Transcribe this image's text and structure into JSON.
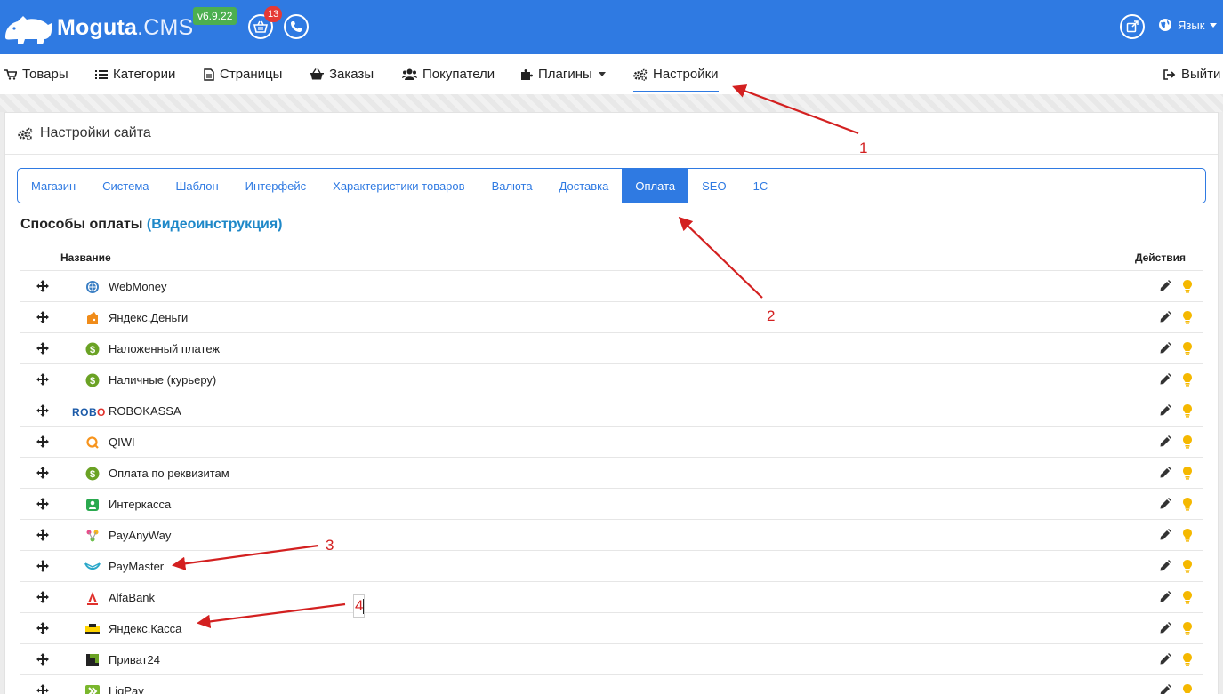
{
  "header": {
    "logo_bold": "Moguta",
    "logo_light": ".CMS",
    "version": "v6.9.22",
    "cart_count": "13",
    "language_label": "Язык",
    "brand_color": "#2f7ae2"
  },
  "nav": {
    "items": [
      {
        "label": "Товары",
        "icon": "cart-icon"
      },
      {
        "label": "Категории",
        "icon": "list-icon"
      },
      {
        "label": "Страницы",
        "icon": "file-icon"
      },
      {
        "label": "Заказы",
        "icon": "basket-icon"
      },
      {
        "label": "Покупатели",
        "icon": "users-icon"
      },
      {
        "label": "Плагины",
        "icon": "puzzle-icon"
      },
      {
        "label": "Настройки",
        "icon": "gears-icon"
      }
    ],
    "logout_label": "Выйти",
    "active": "Настройки"
  },
  "panel": {
    "title": "Настройки сайта",
    "tabs": [
      "Магазин",
      "Система",
      "Шаблон",
      "Интерфейс",
      "Характеристики товаров",
      "Валюта",
      "Доставка",
      "Оплата",
      "SEO",
      "1С"
    ],
    "active_tab": "Оплата",
    "section_title": "Способы оплаты",
    "section_link": "(Видеоинструкция)",
    "col_name": "Название",
    "col_actions": "Действия",
    "payments": [
      {
        "name": "WebMoney",
        "icon": "webmoney-icon"
      },
      {
        "name": "Яндекс.Деньги",
        "icon": "yandex-money-icon"
      },
      {
        "name": "Наложенный платеж",
        "icon": "dollar-icon"
      },
      {
        "name": "Наличные (курьеру)",
        "icon": "dollar-icon"
      },
      {
        "name": "ROBOKASSA",
        "icon": "robokassa-icon"
      },
      {
        "name": "QIWI",
        "icon": "qiwi-icon"
      },
      {
        "name": "Оплата по реквизитам",
        "icon": "dollar-icon"
      },
      {
        "name": "Интеркасса",
        "icon": "interkassa-icon"
      },
      {
        "name": "PayAnyWay",
        "icon": "payanyway-icon"
      },
      {
        "name": "PayMaster",
        "icon": "paymaster-icon"
      },
      {
        "name": "AlfaBank",
        "icon": "alfabank-icon"
      },
      {
        "name": "Яндекс.Касса",
        "icon": "yandex-kassa-icon"
      },
      {
        "name": "Приват24",
        "icon": "privat24-icon"
      },
      {
        "name": "LiqPay",
        "icon": "liqpay-icon"
      }
    ]
  },
  "annotations": [
    "1",
    "2",
    "3",
    "4"
  ],
  "annotation_color": "#d32020"
}
